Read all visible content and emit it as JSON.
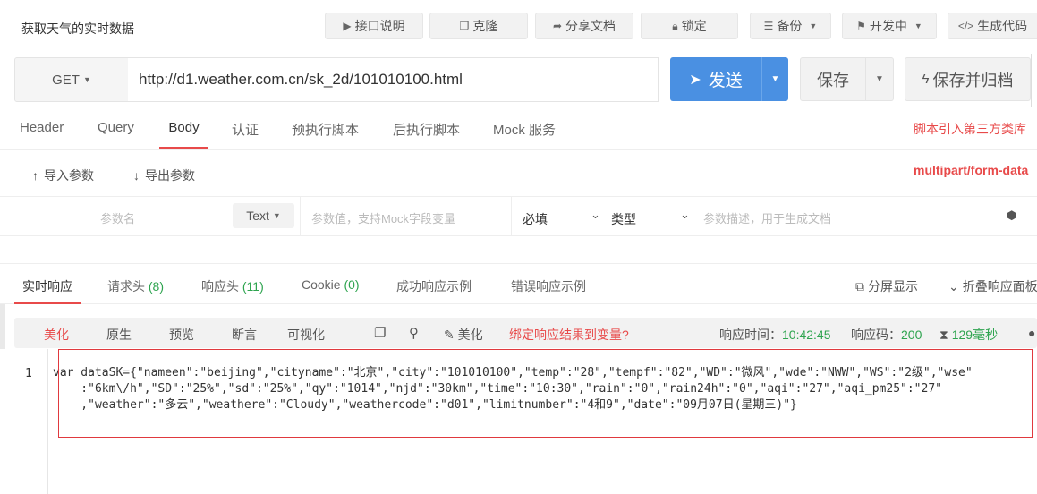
{
  "header": {
    "title": "获取天气的实时数据",
    "buttons": {
      "api_doc": "接口说明",
      "clone": "克隆",
      "share": "分享文档",
      "lock": "锁定",
      "backup": "备份",
      "status": "开发中",
      "gen_code": "生成代码"
    }
  },
  "request": {
    "method": "GET",
    "url": "http://d1.weather.com.cn/sk_2d/101010100.html",
    "send_label": "发送",
    "save_label": "保存",
    "save_archive_label": "保存并归档"
  },
  "req_tabs": [
    "Header",
    "Query",
    "Body",
    "认证",
    "预执行脚本",
    "后执行脚本",
    "Mock 服务"
  ],
  "req_active_tab": "Body",
  "third_party_link": "脚本引入第三方类库",
  "body": {
    "import_label": "导入参数",
    "export_label": "导出参数",
    "form_type": "multipart/form-data",
    "param_name_placeholder": "参数名",
    "type_select": "Text",
    "param_value_placeholder": "参数值，支持Mock字段变量",
    "required_label": "必填",
    "type_label": "类型",
    "param_desc_placeholder": "参数描述，用于生成文档"
  },
  "resp_tabs": {
    "realtime": "实时响应",
    "req_headers": "请求头",
    "req_headers_count": "(8)",
    "resp_headers": "响应头",
    "resp_headers_count": "(11)",
    "cookie": "Cookie",
    "cookie_count": "(0)",
    "success_example": "成功响应示例",
    "error_example": "错误响应示例",
    "split_view": "分屏显示",
    "fold_panel": "折叠响应面板"
  },
  "resp_toolbar": {
    "views": [
      "美化",
      "原生",
      "预览",
      "断言",
      "可视化"
    ],
    "active_view": "美化",
    "beautify_label": "美化",
    "bind_link": "绑定响应结果到变量?",
    "time_label": "响应时间：",
    "time_value": "10:42:45",
    "code_label": "响应码：",
    "code_value": "200",
    "duration": "129毫秒"
  },
  "response_code": {
    "line_number": "1",
    "lines": [
      "var dataSK={\"nameen\":\"beijing\",\"cityname\":\"北京\",\"city\":\"101010100\",\"temp\":\"28\",\"tempf\":\"82\",\"WD\":\"微风\",\"wde\":\"NWW\",\"WS\":\"2级\",\"wse\"",
      "    :\"6km\\/h\",\"SD\":\"25%\",\"sd\":\"25%\",\"qy\":\"1014\",\"njd\":\"30km\",\"time\":\"10:30\",\"rain\":\"0\",\"rain24h\":\"0\",\"aqi\":\"27\",\"aqi_pm25\":\"27\"",
      "    ,\"weather\":\"多云\",\"weathere\":\"Cloudy\",\"weathercode\":\"d01\",\"limitnumber\":\"4和9\",\"date\":\"09月07日(星期三)\"}"
    ]
  }
}
